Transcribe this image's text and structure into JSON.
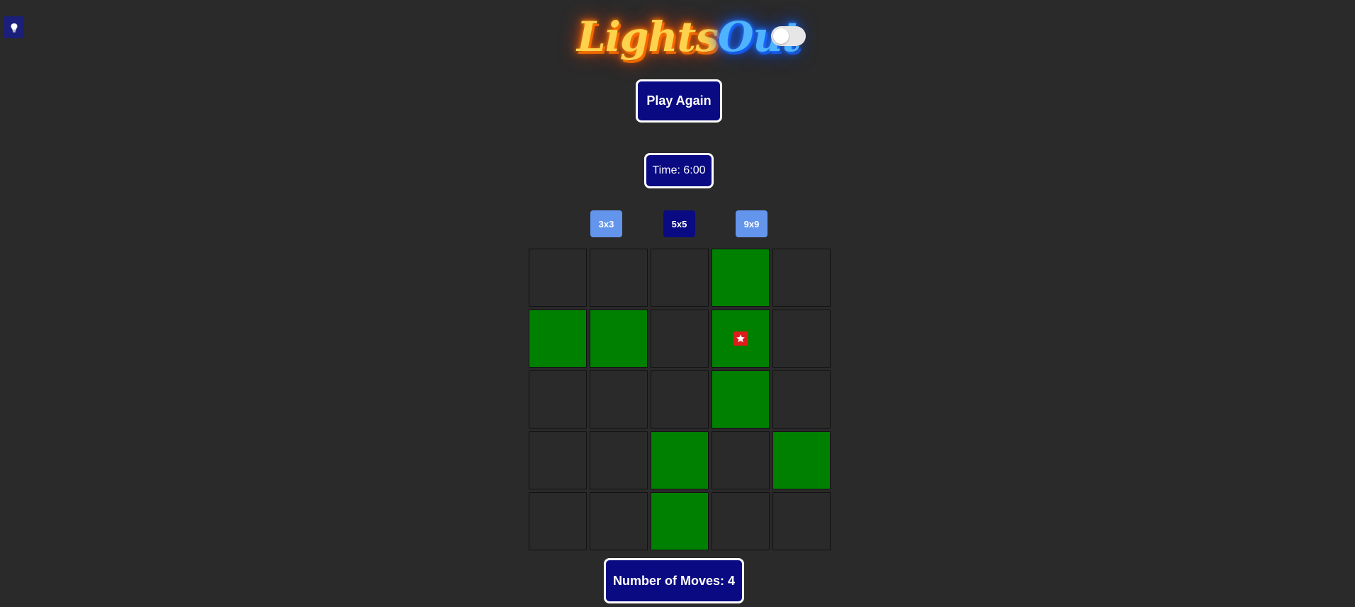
{
  "title": {
    "part1": "Lights",
    "part2": "Out"
  },
  "controls": {
    "play_again_label": "Play Again",
    "timer_text": "Time: 6:00",
    "moves_text": "Number of Moves: 4"
  },
  "size_options": [
    "3x3",
    "5x5",
    "9x9"
  ],
  "selected_size": "5x5",
  "board": {
    "rows": 5,
    "cols": 5,
    "cells": [
      [
        0,
        0,
        0,
        1,
        0
      ],
      [
        1,
        1,
        0,
        1,
        0
      ],
      [
        0,
        0,
        0,
        1,
        0
      ],
      [
        0,
        0,
        1,
        0,
        1
      ],
      [
        0,
        0,
        1,
        0,
        0
      ]
    ],
    "hint_cell": [
      1,
      3
    ]
  },
  "icons": {
    "hint_button": "lightbulb-icon",
    "hint_marker": "star-icon",
    "theme_toggle": "toggle-switch"
  },
  "colors": {
    "background": "#2a2a2a",
    "cell_on": "#008000",
    "button_bg": "#0a0a82",
    "size_inactive": "#6495ed",
    "hint_marker": "#e01b1b"
  }
}
